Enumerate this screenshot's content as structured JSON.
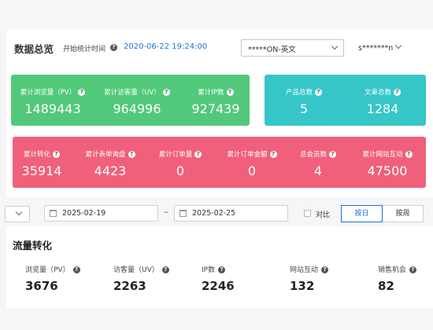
{
  "header": {
    "title": "数据总览",
    "start_label": "开始统计时间",
    "start_time": "2020-06-22 19:24:00",
    "site_select": "*****ON-英文",
    "user": "s*******n"
  },
  "green_card": [
    {
      "label": "累计浏览量（PV）",
      "value": "1489443"
    },
    {
      "label": "累计访客量（UV）",
      "value": "964996"
    },
    {
      "label": "累计IP数",
      "value": "927439"
    }
  ],
  "cyan_card": [
    {
      "label": "产品总数",
      "value": "5"
    },
    {
      "label": "文章总数",
      "value": "1284"
    }
  ],
  "red_card": [
    {
      "label": "累计转化",
      "value": "35914"
    },
    {
      "label": "累计表单询盘",
      "value": "4423"
    },
    {
      "label": "累计订单量",
      "value": "0"
    },
    {
      "label": "累计订单金额",
      "value": "0"
    },
    {
      "label": "总会员数",
      "value": "4"
    },
    {
      "label": "累计网站互动",
      "value": "47500"
    }
  ],
  "filters": {
    "date_start": "2025-02-19",
    "date_end": "2025-02-25",
    "range_sep": "~",
    "compare_label": "对比",
    "by_day": "按日",
    "by_week": "按周"
  },
  "traffic": {
    "title": "流量转化",
    "metrics": [
      {
        "label": "浏览量（PV）",
        "value": "3676"
      },
      {
        "label": "访客量（UV）",
        "value": "2263"
      },
      {
        "label": "IP数",
        "value": "2246"
      },
      {
        "label": "网站互动",
        "value": "132"
      },
      {
        "label": "销售机会",
        "value": "82"
      }
    ]
  },
  "colors": {
    "green": "#52c97a",
    "cyan": "#36c6c8",
    "red": "#f0607a",
    "accent": "#1a73d9"
  },
  "icons": {
    "help": "question-circle-icon",
    "calendar": "calendar-icon",
    "dropdown": "chevron-down-icon"
  }
}
